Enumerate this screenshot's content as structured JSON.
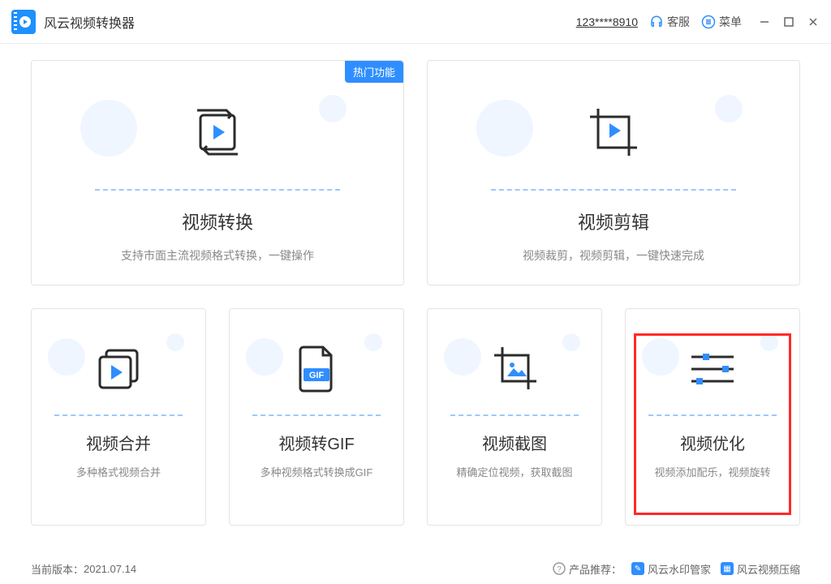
{
  "header": {
    "app_title": "风云视频转换器",
    "user_id": "123****8910",
    "support_label": "客服",
    "menu_label": "菜单"
  },
  "cards": {
    "hot_badge": "热门功能",
    "convert": {
      "title": "视频转换",
      "sub": "支持市面主流视频格式转换，一键操作"
    },
    "edit": {
      "title": "视频剪辑",
      "sub": "视频裁剪，视频剪辑，一键快速完成"
    },
    "merge": {
      "title": "视频合并",
      "sub": "多种格式视频合并"
    },
    "gif": {
      "title": "视频转GIF",
      "sub": "多种视频格式转换成GIF",
      "gif_label": "GIF"
    },
    "shot": {
      "title": "视频截图",
      "sub": "精确定位视频，获取截图"
    },
    "optimize": {
      "title": "视频优化",
      "sub": "视频添加配乐，视频旋转"
    }
  },
  "footer": {
    "version_label": "当前版本：",
    "version_value": "2021.07.14",
    "rec_label": "产品推荐：",
    "rec1": "风云水印管家",
    "rec2": "风云视频压缩"
  },
  "colors": {
    "accent": "#2f8eff"
  }
}
